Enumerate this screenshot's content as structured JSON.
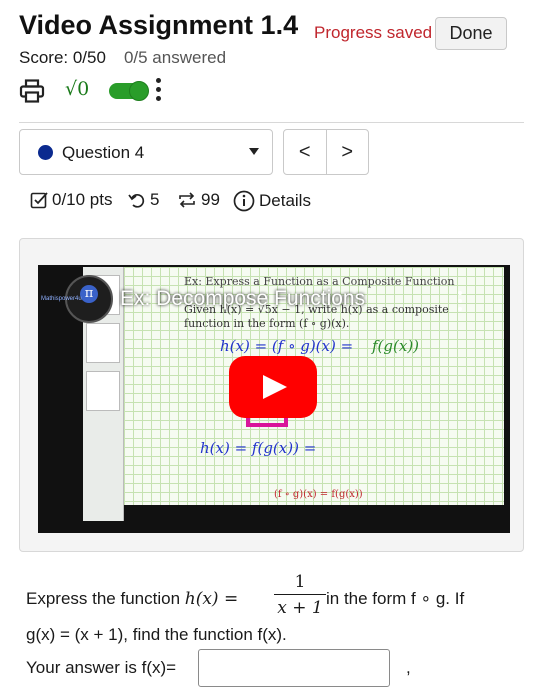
{
  "header": {
    "title": "Video Assignment 1.4",
    "progress_status": "Progress saved",
    "done_label": "Done",
    "score": "Score: 0/50",
    "answered": "0/5 answered"
  },
  "toolbar": {
    "print_icon": "print-icon",
    "math_toggle_label": "√0",
    "math_toggle_on": true,
    "more_icon": "more-vertical-icon"
  },
  "question_nav": {
    "selected_question": "Question 4",
    "prev_label": "<",
    "next_label": ">"
  },
  "question_meta": {
    "points": "0/10 pts",
    "retries": "5",
    "attempts": "99",
    "details_label": "Details"
  },
  "video": {
    "title": "Ex: Decompose Functions",
    "channel": "Mathispower4u",
    "slide_heading": "Ex: Express a Function as a Composite Function",
    "slide_text_line1": "Given h(x) = √5x − 1, write h(x) as a composite",
    "slide_text_line2": "function in the form (f ∘ g)(x).",
    "handwriting": {
      "line1": "h(x) = (f ∘ g)(x) =",
      "line1_tail": "f(g(x))",
      "fx": "f(",
      "gx": "g(",
      "line3": "h(x) = f(g(x)) =",
      "footer": "(f ∘ g)(x) = f(g(x))"
    }
  },
  "problem": {
    "text_before_fraction": "Express the function ",
    "fn_lhs": "h(x) = ",
    "fraction_numerator": "1",
    "fraction_denominator": "x + 1",
    "text_after_fraction": " in the form f ∘ g. If",
    "line2": "g(x) = (x + 1), find the function f(x).",
    "answer_prompt": "Your answer is f(x)=",
    "answer_value": "",
    "trailing": ","
  },
  "colors": {
    "progress_status": "#c0262d",
    "toggle": "#2a9d2a",
    "question_dot": "#0b2a8f",
    "youtube_red": "#ff0000"
  }
}
